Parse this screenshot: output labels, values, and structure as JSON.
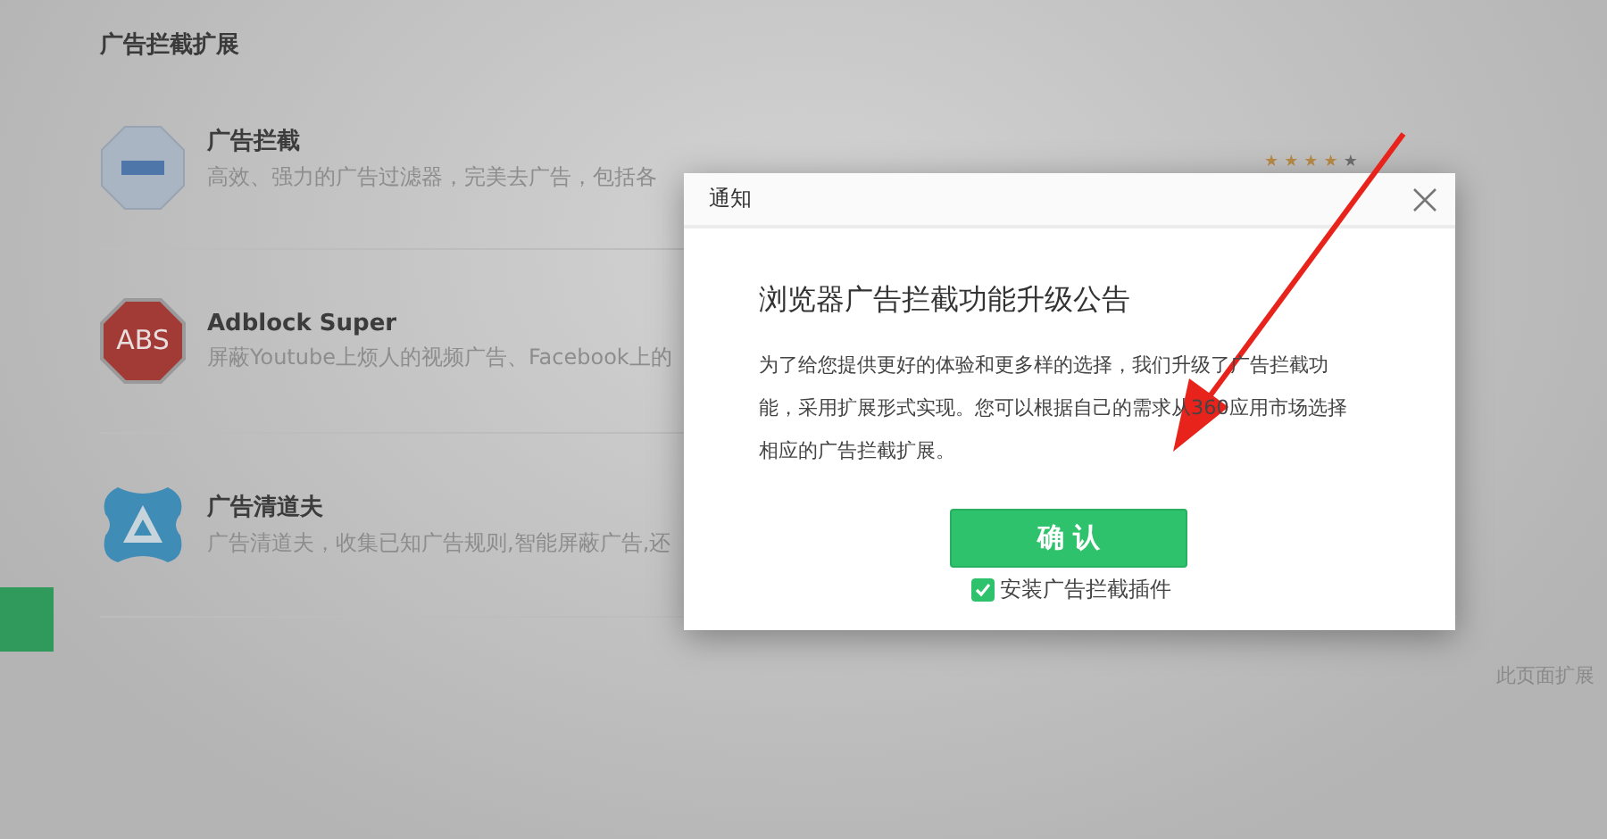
{
  "page": {
    "heading": "广告拦截扩展",
    "extensions": [
      {
        "kind": "block",
        "title": "广告拦截",
        "description": "高效、强力的广告过滤器，完美去广告，包括各",
        "stars": 4
      },
      {
        "kind": "abs",
        "icon_text": "ABS",
        "title": "Adblock Super",
        "description": "屏蔽Youtube上烦人的视频广告、Facebook上的"
      },
      {
        "kind": "triangle",
        "title": "广告清道夫",
        "description": "广告清道夫，收集已知广告规则,智能屏蔽广告,还"
      }
    ],
    "footer_note": "此页面扩展"
  },
  "dialog": {
    "title": "通知",
    "heading": "浏览器广告拦截功能升级公告",
    "body": "为了给您提供更好的体验和更多样的选择，我们升级了广告拦截功能，采用扩展形式实现。您可以根据自己的需求从360应用市场选择相应的广告拦截扩展。",
    "confirm_button": "确 认",
    "install_checkbox": {
      "label": "安装广告拦截插件",
      "checked": true
    }
  }
}
